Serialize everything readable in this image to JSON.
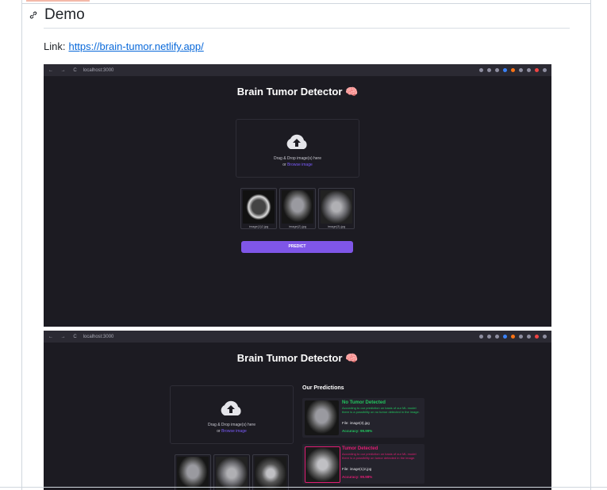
{
  "heading": {
    "title": "Demo"
  },
  "link": {
    "label": "Link:",
    "url_text": "https://brain-tumor.netlify.app/"
  },
  "browser": {
    "url": "localhost:3000",
    "nav": "← → C"
  },
  "app": {
    "title": "Brain Tumor Detector 🧠",
    "drop_text": "Drag & Drop image(s) here",
    "or_text": "or",
    "browse_text": "Browse image",
    "predict_label": "PREDICT",
    "thumbnails": [
      "image(1)2.jpg",
      "image(2).jpg",
      "image(3).jpg"
    ],
    "predictions_title": "Our Predictions",
    "predictions": [
      {
        "title": "No Tumor Detected",
        "desc": "According to our prediction on basis of our ML model there is a possibility on no tumor detected in the image.",
        "file": "File: image(3).jpg",
        "accuracy": "Accuracy: 99.99%",
        "color": "#22c55e"
      },
      {
        "title": "Tumor Detected",
        "desc": "According to our prediction on basis of our ML model there is a possibility on tumor detected in the image.",
        "file": "File: image(1)2.jpg",
        "accuracy": "Accuracy: 99.98%",
        "color": "#e11d74"
      }
    ]
  },
  "colors": {
    "accent": "#7f56e8",
    "link": "#0969da",
    "app_bg": "#1c1b22"
  }
}
